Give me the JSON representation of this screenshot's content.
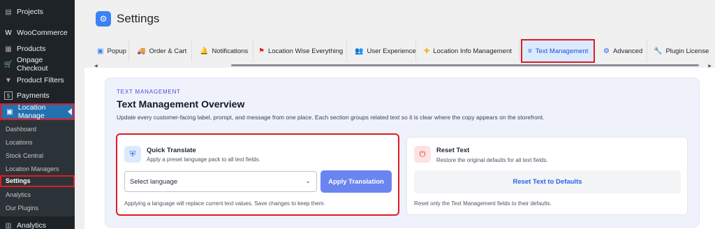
{
  "sidebar": {
    "items": [
      {
        "label": "Projects",
        "icon": "projects-icon",
        "glyph": "▤"
      },
      {
        "label": "WooCommerce",
        "icon": "woocommerce-icon",
        "glyph": "W"
      },
      {
        "label": "Products",
        "icon": "products-icon",
        "glyph": "▦"
      },
      {
        "label": "Onpage Checkout",
        "icon": "cart-icon",
        "glyph": "🛒"
      },
      {
        "label": "Product Filters",
        "icon": "filter-icon",
        "glyph": "▼"
      },
      {
        "label": "Payments",
        "icon": "payments-icon",
        "glyph": "$"
      },
      {
        "label": "Location Manage",
        "icon": "location-manage-icon",
        "glyph": "▣"
      }
    ],
    "subitems": [
      "Dashboard",
      "Locations",
      "Stock Central",
      "Location Managers",
      "Settings",
      "Analytics",
      "Our Plugins"
    ],
    "bottom_item": {
      "label": "Analytics",
      "glyph": "▥"
    }
  },
  "header": {
    "title": "Settings",
    "icon": "gear-icon"
  },
  "tabs": [
    {
      "label": "Popup",
      "glyph": "▣",
      "color": "#3b82f6"
    },
    {
      "label": "Order & Cart",
      "glyph": "🚚",
      "color": "#f97316"
    },
    {
      "label": "Notifications",
      "glyph": "🔔",
      "color": "#f97316"
    },
    {
      "label": "Location Wise Everything",
      "glyph": "⚑",
      "color": "#dc2626"
    },
    {
      "label": "User Experience",
      "glyph": "👥",
      "color": "#06b6d4"
    },
    {
      "label": "Location Info Management",
      "glyph": "✚",
      "color": "#eab308"
    },
    {
      "label": "Text Management",
      "glyph": "≡",
      "color": "#2563eb"
    },
    {
      "label": "Advanced",
      "glyph": "⚙",
      "color": "#2563eb"
    },
    {
      "label": "Plugin License",
      "glyph": "🔧",
      "color": "#3b82f6"
    }
  ],
  "overview": {
    "eyebrow": "TEXT MANAGEMENT",
    "title": "Text Management Overview",
    "description": "Update every customer-facing label, prompt, and message from one place. Each section groups related text so it is clear where the copy appears on the storefront."
  },
  "quick_translate": {
    "title": "Quick Translate",
    "subtitle": "Apply a preset language pack to all text fields.",
    "select_value": "Select language",
    "button": "Apply Translation",
    "note": "Applying a language will replace current text values. Save changes to keep them."
  },
  "reset_text": {
    "title": "Reset Text",
    "subtitle": "Restore the original defaults for all text fields.",
    "button": "Reset Text to Defaults",
    "note": "Reset only the Text Management fields to their defaults."
  }
}
